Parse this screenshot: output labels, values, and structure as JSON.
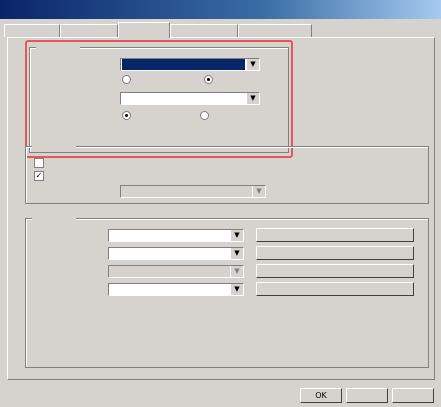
{
  "window": {
    "title": ""
  },
  "tabs": [
    {
      "label": ""
    },
    {
      "label": ""
    },
    {
      "label": ""
    },
    {
      "label": ""
    },
    {
      "label": ""
    }
  ],
  "active_tab_index": 2,
  "plan_group": {
    "legend": "",
    "plan_label": "",
    "plan_value": "",
    "radio_basic": "",
    "radio_flexible": "",
    "discount_label": "",
    "discount_value": "",
    "row3_label": "",
    "row3_radio_a": "",
    "row3_radio_b": ""
  },
  "notify_group": {
    "legend": "",
    "check1": "",
    "check2": "",
    "sub_label": "",
    "sub_value": ""
  },
  "access_group": {
    "legend": "",
    "rows": [
      {
        "label": "",
        "value": "",
        "button": ""
      },
      {
        "label": "",
        "value": "",
        "button": ""
      },
      {
        "label": "",
        "value": "",
        "button": ""
      },
      {
        "label": "",
        "value": "",
        "button": ""
      }
    ],
    "note1_line1": "",
    "note1_line2": "",
    "note2_line1": "",
    "note2_line2": ""
  },
  "buttons": {
    "ok": "OK",
    "cancel": "",
    "help": ""
  },
  "colors": {
    "highlight_frame": "#e4585c",
    "selection": "#0a246a"
  }
}
